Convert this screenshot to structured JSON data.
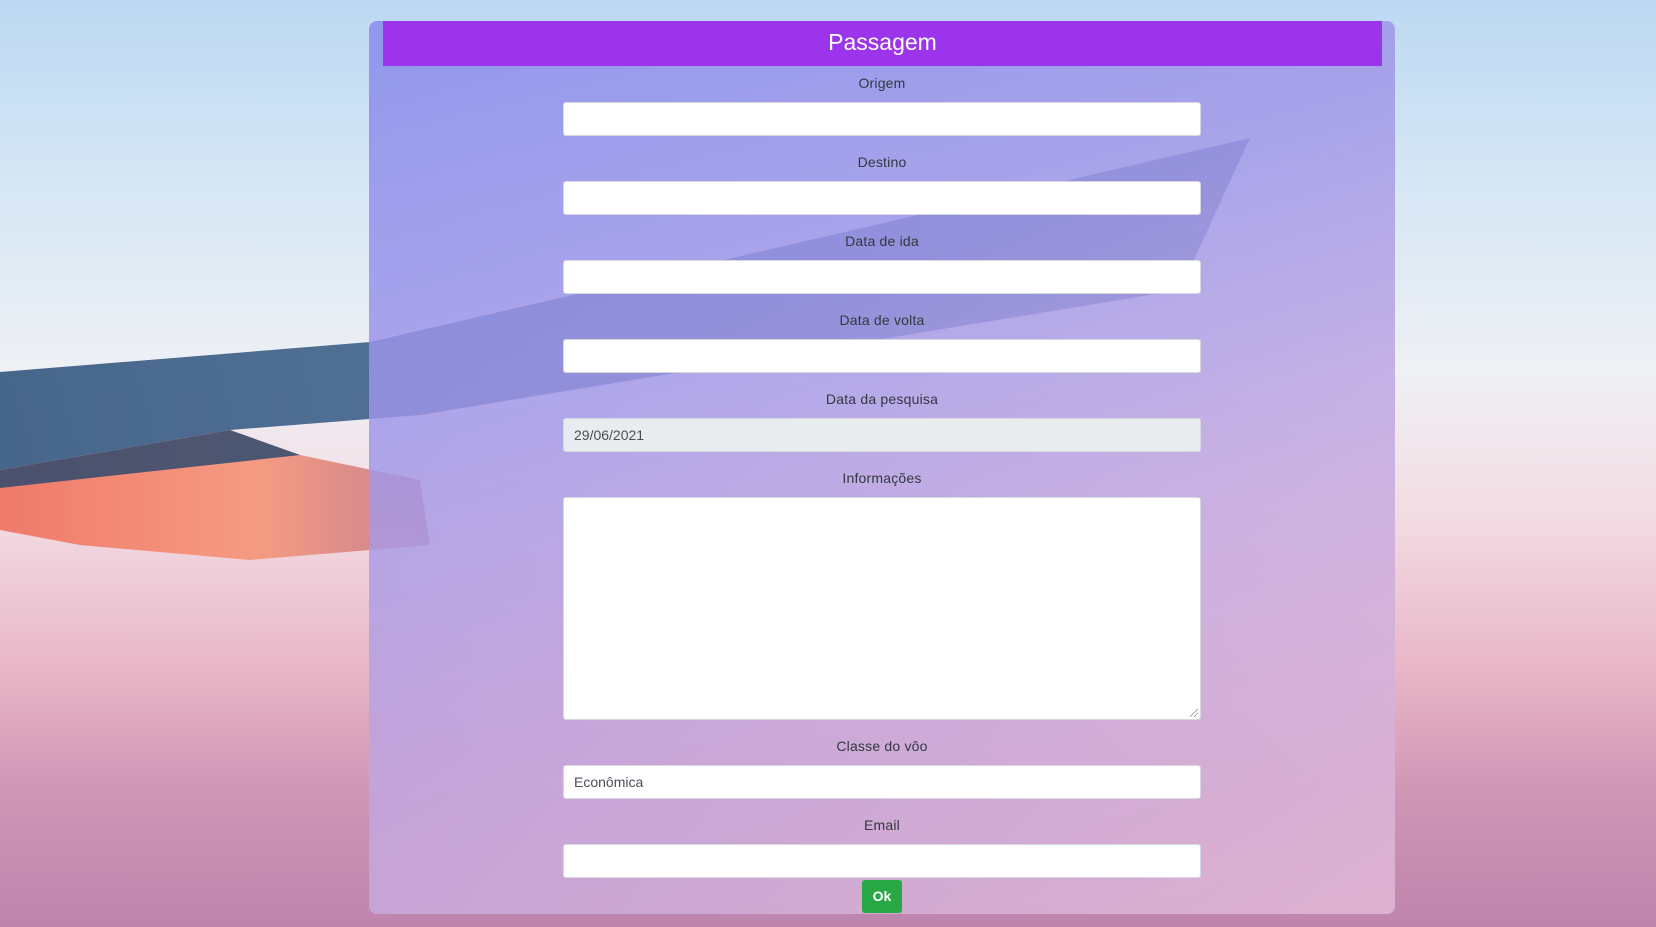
{
  "header": {
    "title": "Passagem"
  },
  "form": {
    "origem": {
      "label": "Origem",
      "value": ""
    },
    "destino": {
      "label": "Destino",
      "value": ""
    },
    "data_ida": {
      "label": "Data de ida",
      "value": ""
    },
    "data_volta": {
      "label": "Data de volta",
      "value": ""
    },
    "data_pesquisa": {
      "label": "Data da pesquisa",
      "value": "29/06/2021"
    },
    "informacoes": {
      "label": "Informações",
      "value": ""
    },
    "classe": {
      "label": "Classe do vôo",
      "value": "Econômica"
    },
    "email": {
      "label": "Email",
      "value": ""
    },
    "submit_label": "Ok"
  },
  "colors": {
    "header": "#9b34ea",
    "submit": "#28a745",
    "readonly_field": "#e9ecef"
  }
}
